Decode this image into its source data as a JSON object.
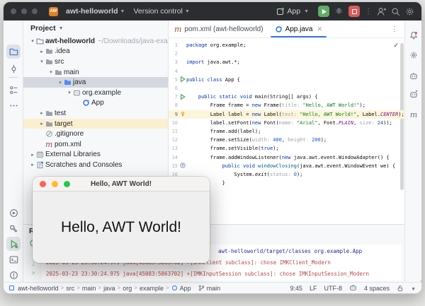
{
  "colors": {
    "accent": "#3574F0",
    "run_green": "#5FAD65",
    "stop_red": "#DB5C5C",
    "keyword": "#0033B3",
    "string": "#067D17",
    "number": "#1750EB",
    "inlay_hint": "#9DA0A8",
    "constant": "#871094",
    "method": "#00627A",
    "console_cmd": "#27279F",
    "console_err": "#B94A48",
    "current_line": "#FCF5DA",
    "excluded_row": "#FAF0D0"
  },
  "titlebar": {
    "project_name": "awt-helloworld",
    "vcs_menu": "Version control",
    "run_config": "App",
    "project_badge": "AW"
  },
  "project_panel": {
    "title": "Project",
    "tree": [
      {
        "indent": 0,
        "twisty": "v",
        "icon": "folder-project",
        "label": "awt-helloworld",
        "path": "~/Downloads/java-examples/aw",
        "bold": true
      },
      {
        "indent": 1,
        "twisty": ">",
        "icon": "folder",
        "label": ".idea"
      },
      {
        "indent": 1,
        "twisty": "v",
        "icon": "folder",
        "label": "src"
      },
      {
        "indent": 2,
        "twisty": "v",
        "icon": "folder",
        "label": "main"
      },
      {
        "indent": 3,
        "twisty": "v",
        "icon": "folder-src",
        "label": "java",
        "selected": true
      },
      {
        "indent": 4,
        "twisty": "v",
        "icon": "package",
        "label": "org.example"
      },
      {
        "indent": 5,
        "twisty": "",
        "icon": "class",
        "label": "App"
      },
      {
        "indent": 1,
        "twisty": ">",
        "icon": "folder",
        "label": "test"
      },
      {
        "indent": 1,
        "twisty": ">",
        "icon": "folder",
        "label": "target",
        "highlighted": true
      },
      {
        "indent": 1,
        "twisty": "",
        "icon": "ignored",
        "label": ".gitignore"
      },
      {
        "indent": 1,
        "twisty": "",
        "icon": "maven",
        "label": "pom.xml"
      },
      {
        "indent": 0,
        "twisty": ">",
        "icon": "libraries",
        "label": "External Libraries"
      },
      {
        "indent": 0,
        "twisty": ">",
        "icon": "scratches",
        "label": "Scratches and Consoles"
      }
    ]
  },
  "tabs": [
    {
      "label": "pom.xml (awt-helloworld)",
      "icon": "maven",
      "active": false,
      "closable": false
    },
    {
      "label": "App.java",
      "icon": "class",
      "active": true,
      "closable": true
    }
  ],
  "editor": {
    "inspection_status": "✓",
    "lines": [
      {
        "num": 1,
        "gutter": "",
        "tokens": [
          [
            "package",
            "k"
          ],
          [
            " org.example;",
            "p"
          ]
        ]
      },
      {
        "num": 2,
        "gutter": "",
        "tokens": []
      },
      {
        "num": 3,
        "gutter": "",
        "tokens": [
          [
            "import",
            "k"
          ],
          [
            " java.awt.*;",
            "p"
          ]
        ]
      },
      {
        "num": 4,
        "gutter": "",
        "tokens": []
      },
      {
        "num": 5,
        "gutter": "run",
        "tokens": [
          [
            "public class",
            "k"
          ],
          [
            " App {",
            "p"
          ]
        ]
      },
      {
        "num": 6,
        "gutter": "",
        "tokens": []
      },
      {
        "num": 7,
        "gutter": "run",
        "tokens": [
          [
            "    ",
            "p"
          ],
          [
            "public static void",
            "k"
          ],
          [
            " main(String[] args) {",
            "p"
          ]
        ]
      },
      {
        "num": 8,
        "gutter": "",
        "tokens": [
          [
            "        Frame frame = ",
            "p"
          ],
          [
            "new",
            "k"
          ],
          [
            " Frame(",
            "p"
          ],
          [
            "title: ",
            "h"
          ],
          [
            "\"Hello, AWT World!\"",
            "s"
          ],
          [
            ");",
            "p"
          ]
        ]
      },
      {
        "num": 9,
        "gutter": "bulb",
        "current": true,
        "tokens": [
          [
            "        Label label = ",
            "p"
          ],
          [
            "new",
            "k"
          ],
          [
            " Label(",
            "p"
          ],
          [
            "text: ",
            "h"
          ],
          [
            "\"Hello, AWT World!\"",
            "s"
          ],
          [
            ", Label.",
            "p"
          ],
          [
            "CENTER",
            "f"
          ],
          [
            ");",
            "p"
          ]
        ]
      },
      {
        "num": 10,
        "gutter": "",
        "tokens": [
          [
            "        label.setFont(",
            "p"
          ],
          [
            "new",
            "k"
          ],
          [
            " Font(",
            "p"
          ],
          [
            "name: ",
            "h"
          ],
          [
            "\"Arial\"",
            "s"
          ],
          [
            ", Font.",
            "p"
          ],
          [
            "PLAIN",
            "f"
          ],
          [
            ", ",
            "p"
          ],
          [
            "size: ",
            "h"
          ],
          [
            "24",
            "n"
          ],
          [
            "));",
            "p"
          ]
        ]
      },
      {
        "num": 11,
        "gutter": "",
        "tokens": [
          [
            "        frame.add(label);",
            "p"
          ]
        ]
      },
      {
        "num": 12,
        "gutter": "",
        "tokens": [
          [
            "        frame.setSize(",
            "p"
          ],
          [
            "width: ",
            "h"
          ],
          [
            "400",
            "n"
          ],
          [
            ", ",
            "p"
          ],
          [
            "height: ",
            "h"
          ],
          [
            "200",
            "n"
          ],
          [
            ");",
            "p"
          ]
        ]
      },
      {
        "num": 13,
        "gutter": "",
        "tokens": [
          [
            "        frame.setVisible(",
            "p"
          ],
          [
            "true",
            "k"
          ],
          [
            ");",
            "p"
          ]
        ]
      },
      {
        "num": 14,
        "gutter": "",
        "tokens": [
          [
            "        frame.addWindowListener(",
            "p"
          ],
          [
            "new",
            "k"
          ],
          [
            " java.awt.event.WindowAdapter() {",
            "p"
          ]
        ]
      },
      {
        "num": 15,
        "gutter": "override",
        "tokens": [
          [
            "            ",
            "p"
          ],
          [
            "public void",
            "k"
          ],
          [
            " ",
            "p"
          ],
          [
            "windowClosing",
            "m"
          ],
          [
            "(java.awt.event.WindowEvent we) {",
            "p"
          ]
        ]
      },
      {
        "num": 16,
        "gutter": "",
        "tokens": [
          [
            "                System.",
            "p"
          ],
          [
            "exit",
            "st"
          ],
          [
            "(",
            "p"
          ],
          [
            "status: ",
            "h"
          ],
          [
            "0",
            "n"
          ],
          [
            ");",
            "p"
          ]
        ]
      },
      {
        "num": 17,
        "gutter": "",
        "tokens": [
          [
            "            }",
            "p"
          ]
        ]
      }
    ]
  },
  "run_panel": {
    "title": "Run",
    "console": [
      {
        "text": "awt-helloworld/target/classes org.example.App",
        "cls": "cmd",
        "offset": 243
      },
      {
        "text": "2025-03-23 23:30:24.975 java[45083:5863702] +[IMKClient subclass]: chose IMKClient_Modern",
        "cls": "err",
        "offset": 0
      },
      {
        "text": "2025-03-23 23:30:24.975 java[45083:5863702] +[IMKInputSession subclass]: chose IMKInputSession_Modern",
        "cls": "err",
        "offset": 0
      }
    ]
  },
  "status_bar": {
    "breadcrumbs": [
      "awt-helloworld",
      "src",
      "main",
      "java",
      "org",
      "example",
      "App"
    ],
    "branch": "main",
    "caret": "9:45",
    "line_ending": "LF",
    "encoding": "UTF-8",
    "indent": "4 spaces"
  },
  "awt_window": {
    "title": "Hello, AWT World!",
    "label": "Hello, AWT World!"
  }
}
